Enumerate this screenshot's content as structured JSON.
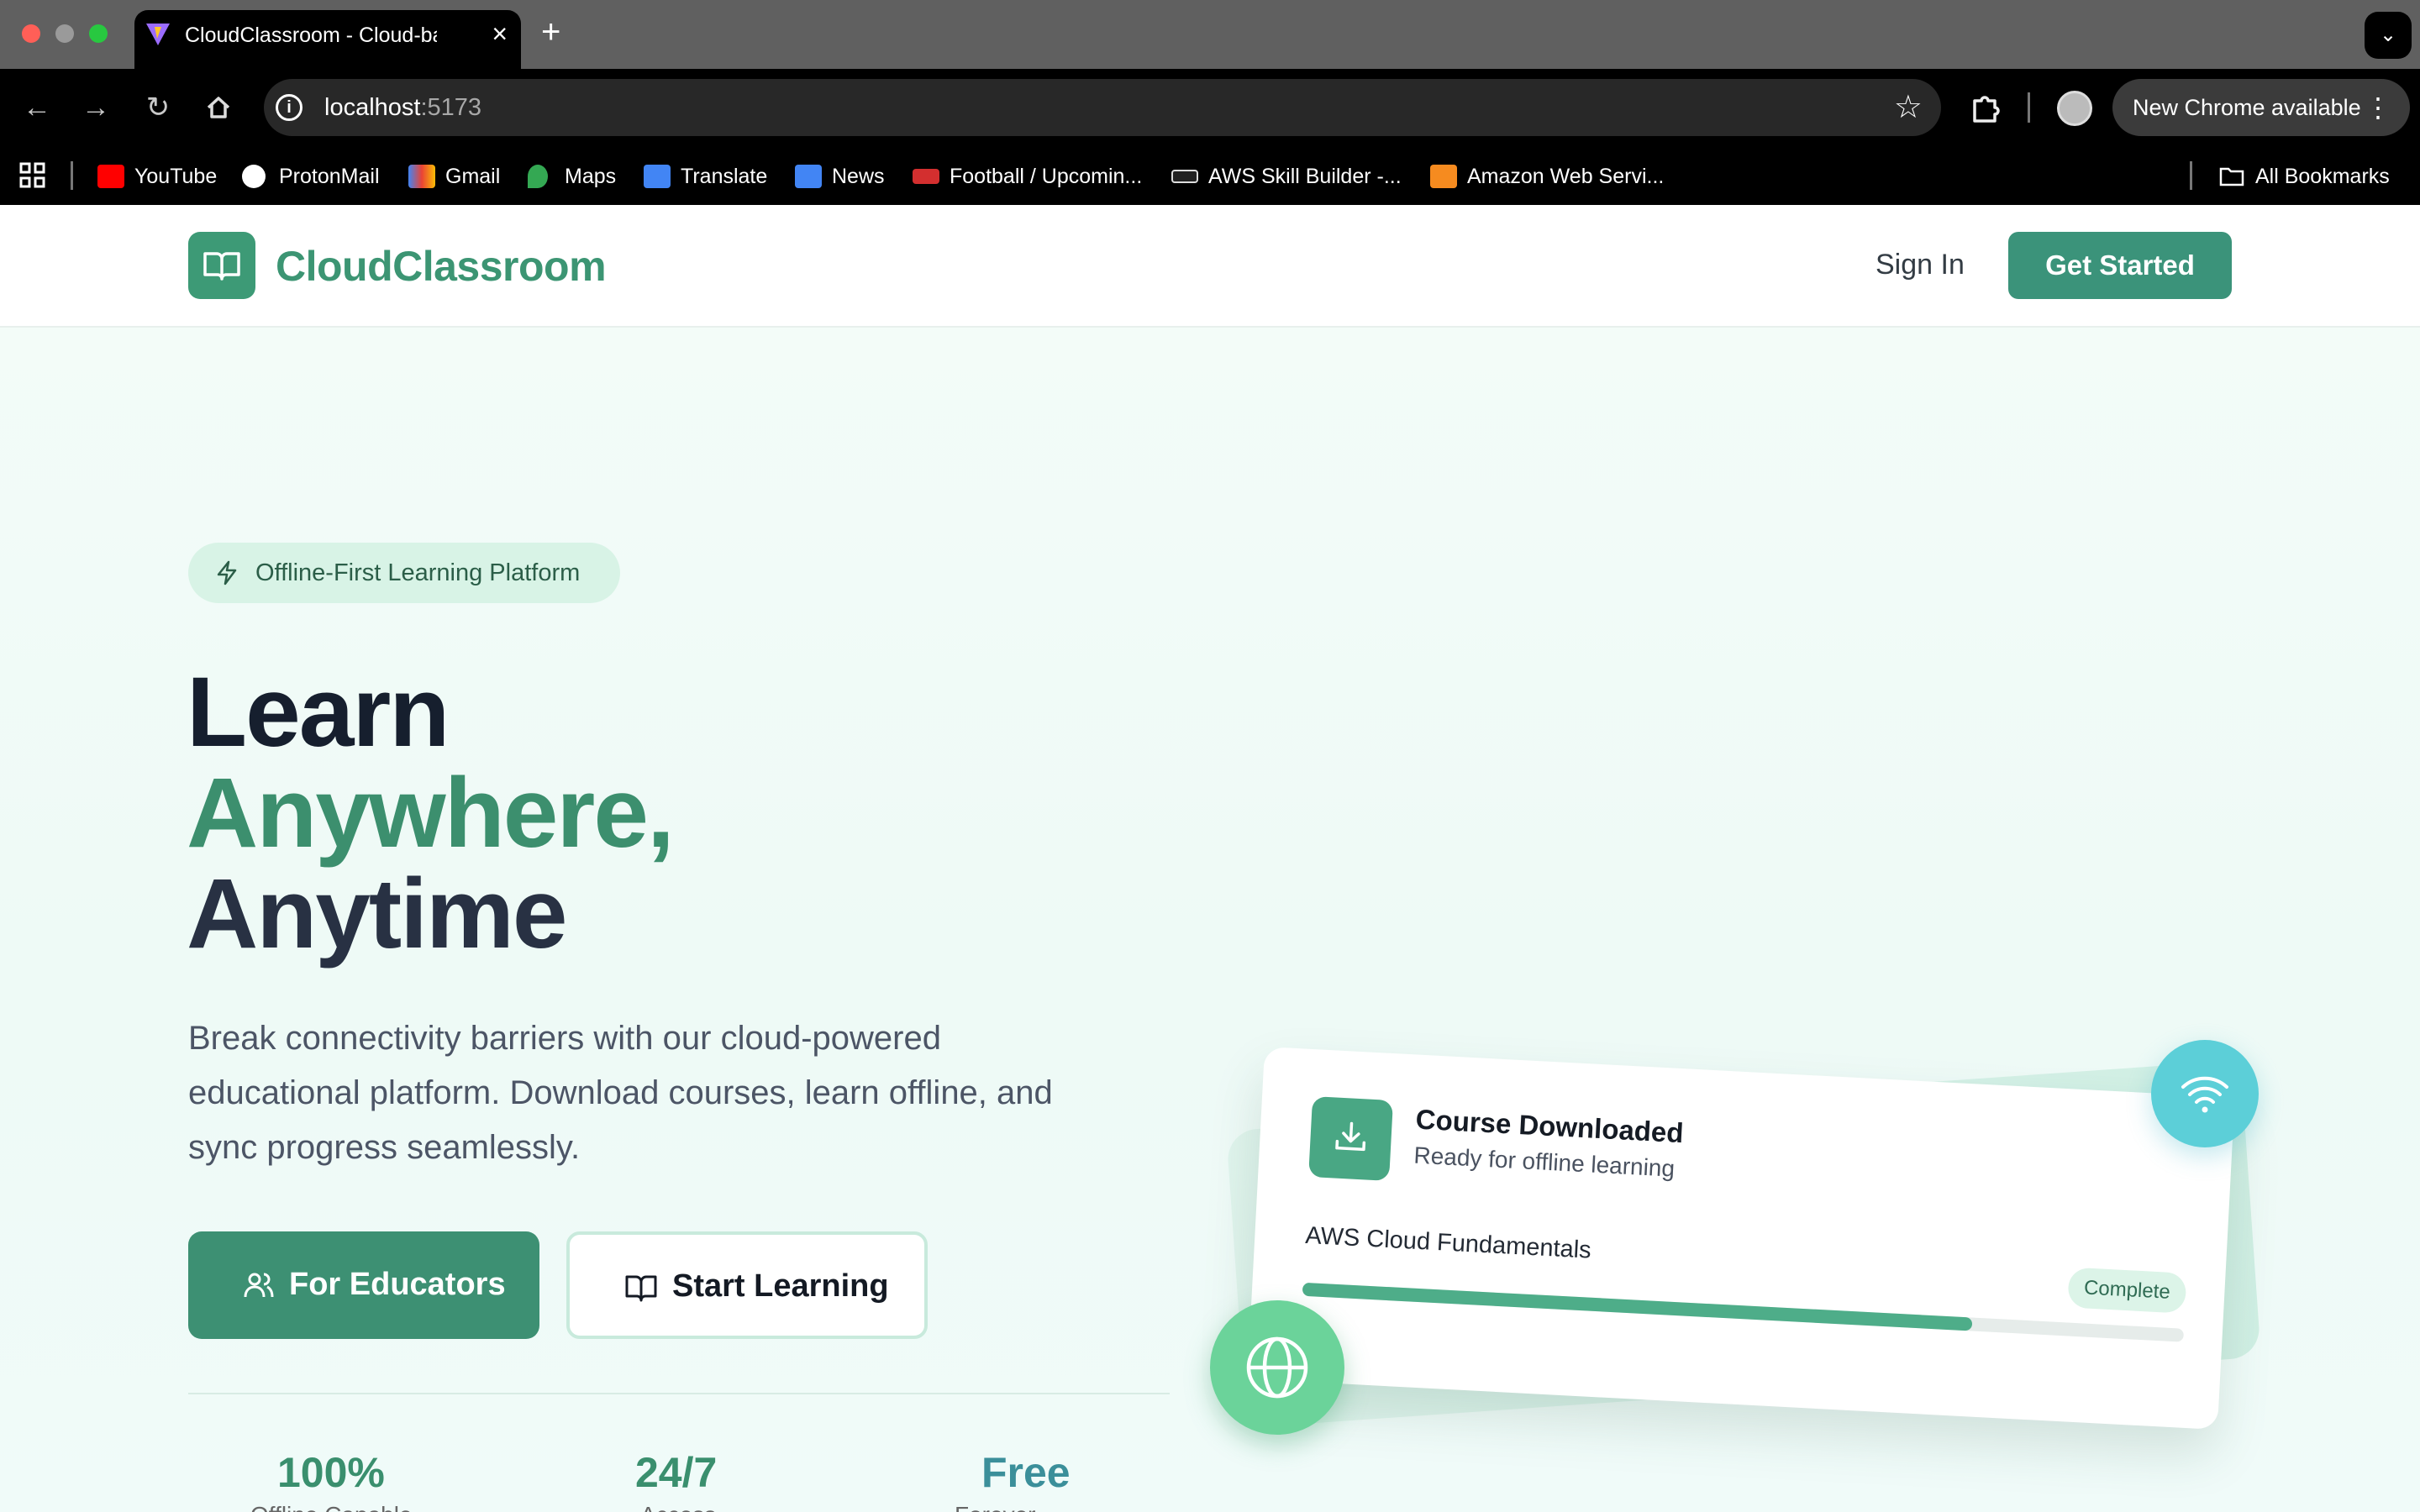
{
  "browser": {
    "tab_title": "CloudClassroom - Cloud-based",
    "url_host": "localhost",
    "url_port": ":5173",
    "update_label": "New Chrome available",
    "bookmarks": [
      {
        "label": "YouTube",
        "icon": "youtube-icon",
        "color": "#ff0000"
      },
      {
        "label": "ProtonMail",
        "icon": "protonmail-icon",
        "color": "#ffffff"
      },
      {
        "label": "Gmail",
        "icon": "gmail-icon",
        "color": "#ea4335"
      },
      {
        "label": "Maps",
        "icon": "maps-icon",
        "color": "#34a853"
      },
      {
        "label": "Translate",
        "icon": "translate-icon",
        "color": "#4285f4"
      },
      {
        "label": "News",
        "icon": "news-icon",
        "color": "#4285f4"
      },
      {
        "label": "Football / Upcomin...",
        "icon": "live-icon",
        "color": "#d32f2f"
      },
      {
        "label": "AWS Skill Builder -...",
        "icon": "aws-icon",
        "color": "#ffffff"
      },
      {
        "label": "Amazon Web Servi...",
        "icon": "aws-cube-icon",
        "color": "#f68b1f"
      }
    ],
    "all_bookmarks": "All Bookmarks"
  },
  "header": {
    "brand": "CloudClassroom",
    "sign_in": "Sign In",
    "get_started": "Get Started"
  },
  "hero": {
    "badge": "Offline-First Learning Platform",
    "title_line1": "Learn",
    "title_line2": "Anywhere,",
    "title_line3": "Anytime",
    "subtitle": "Break connectivity barriers with our cloud-powered educational platform. Download courses, learn offline, and sync progress seamlessly.",
    "btn_educators": "For Educators",
    "btn_learning": "Start Learning"
  },
  "stats": [
    {
      "value": "100%",
      "label": "Offline Capable"
    },
    {
      "value": "24/7",
      "label": "Access"
    },
    {
      "value": "Free",
      "label": "Forever"
    }
  ],
  "card": {
    "title": "Course Downloaded",
    "subtitle": "Ready for offline learning",
    "course": "AWS Cloud Fundamentals",
    "status": "Complete",
    "progress": 0.76
  },
  "colors": {
    "brand": "#3c9573",
    "accent_teal": "#5ccfd8",
    "accent_green": "#6bd39a"
  }
}
